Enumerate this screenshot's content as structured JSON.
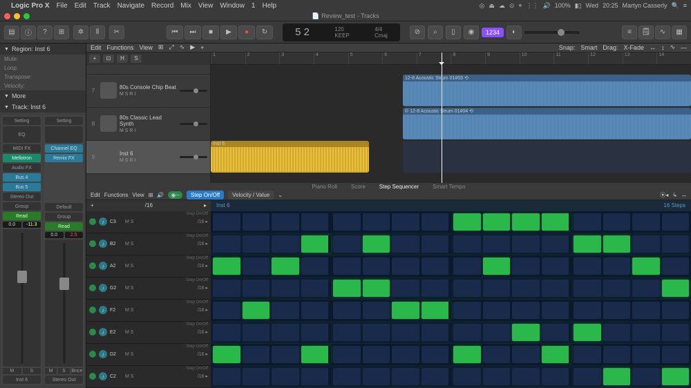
{
  "menubar": {
    "app": "Logic Pro X",
    "items": [
      "File",
      "Edit",
      "Track",
      "Navigate",
      "Record",
      "Mix",
      "View",
      "Window",
      "1",
      "Help"
    ],
    "battery": "100%",
    "day": "Wed",
    "time": "20:25",
    "user": "Martyn Casserly"
  },
  "window": {
    "title": "Review_test - Tracks"
  },
  "lcd": {
    "position": "5 2",
    "tempo": "120",
    "keep": "KEEP",
    "sig": "4/4",
    "key": "Cmaj"
  },
  "toolbar": {
    "beat_label": "1234"
  },
  "inspector": {
    "region_header": "Region: Inst 6",
    "rows": [
      "Mute:",
      "Loop:",
      "Transpose:",
      "Velocity:"
    ],
    "more": "More",
    "track_header": "Track: Inst 6",
    "strip1": {
      "setting": "Setting",
      "eq": "EQ",
      "midifx": "MIDI FX",
      "inst": "Mellotron",
      "audiofx": "Audio FX",
      "send1": "Bus 4",
      "send2": "Bus 5",
      "out": "Stereo Out",
      "group": "Group",
      "read": "Read",
      "db1": "0.0",
      "db2": "-11.3",
      "name": "Inst 6"
    },
    "strip2": {
      "setting": "Setting",
      "eq1": "Channel EQ",
      "eq2": "Remix FX",
      "read": "Read",
      "default": "Default",
      "db1": "0.0",
      "db2": "2.5",
      "bnce": "Bnce",
      "name": "Stereo Out"
    }
  },
  "tracks_header": {
    "edit": "Edit",
    "functions": "Functions",
    "view": "View",
    "snap": "Snap:",
    "snap_val": "Smart",
    "drag": "Drag:",
    "drag_val": "X-Fade"
  },
  "ruler": [
    "1",
    "2",
    "3",
    "4",
    "5",
    "6",
    "7",
    "8",
    "9",
    "10",
    "11",
    "12",
    "13",
    "14"
  ],
  "tracks": [
    {
      "num": "7",
      "name": "80s Console Chip Beat",
      "btns": "M  S  R  I"
    },
    {
      "num": "8",
      "name": "80s Classic Lead Synth",
      "btns": "M  S  R  I"
    },
    {
      "num": "9",
      "name": "Inst 6",
      "btns": "M  S  R  I",
      "sel": true
    }
  ],
  "regions": {
    "audio1": "12-8 Acoustic Strum 01#03 ⟲",
    "audio2": "© 12-8 Acoustic Strum 01#04 ⟲",
    "midi": "Inst 6"
  },
  "editor_tabs": [
    "Piano Roll",
    "Score",
    "Step Sequencer",
    "Smart Tempo"
  ],
  "editor_toolbar": {
    "edit": "Edit",
    "functions": "Functions",
    "view": "View",
    "stepon": "Step On/Off",
    "velval": "Velocity / Value",
    "div": "/16"
  },
  "step": {
    "region": "Inst 6",
    "steps_label": "16 Steps",
    "row_label": "Step On/Off",
    "rows": [
      {
        "note": "C3",
        "pattern": [
          0,
          0,
          0,
          0,
          0,
          0,
          0,
          0,
          1,
          1,
          1,
          1,
          0,
          0,
          0,
          0
        ]
      },
      {
        "note": "B2",
        "pattern": [
          0,
          0,
          0,
          1,
          0,
          1,
          0,
          0,
          0,
          0,
          0,
          0,
          1,
          1,
          0,
          0
        ]
      },
      {
        "note": "A2",
        "pattern": [
          1,
          0,
          1,
          0,
          0,
          0,
          0,
          0,
          0,
          1,
          0,
          0,
          0,
          0,
          1,
          0
        ]
      },
      {
        "note": "G2",
        "pattern": [
          0,
          0,
          0,
          0,
          1,
          1,
          0,
          0,
          0,
          0,
          0,
          0,
          0,
          0,
          0,
          1
        ]
      },
      {
        "note": "F2",
        "pattern": [
          0,
          1,
          0,
          0,
          0,
          0,
          1,
          1,
          0,
          0,
          0,
          0,
          0,
          0,
          0,
          0
        ]
      },
      {
        "note": "E2",
        "pattern": [
          0,
          0,
          0,
          0,
          0,
          0,
          0,
          0,
          0,
          0,
          1,
          0,
          1,
          0,
          0,
          0
        ]
      },
      {
        "note": "D2",
        "pattern": [
          1,
          0,
          0,
          1,
          0,
          0,
          0,
          0,
          1,
          0,
          0,
          1,
          0,
          0,
          0,
          0
        ]
      },
      {
        "note": "C2",
        "pattern": [
          0,
          0,
          0,
          0,
          0,
          0,
          0,
          0,
          0,
          0,
          0,
          0,
          0,
          1,
          0,
          1
        ]
      }
    ],
    "ms": "M  S",
    "div": "/16"
  }
}
